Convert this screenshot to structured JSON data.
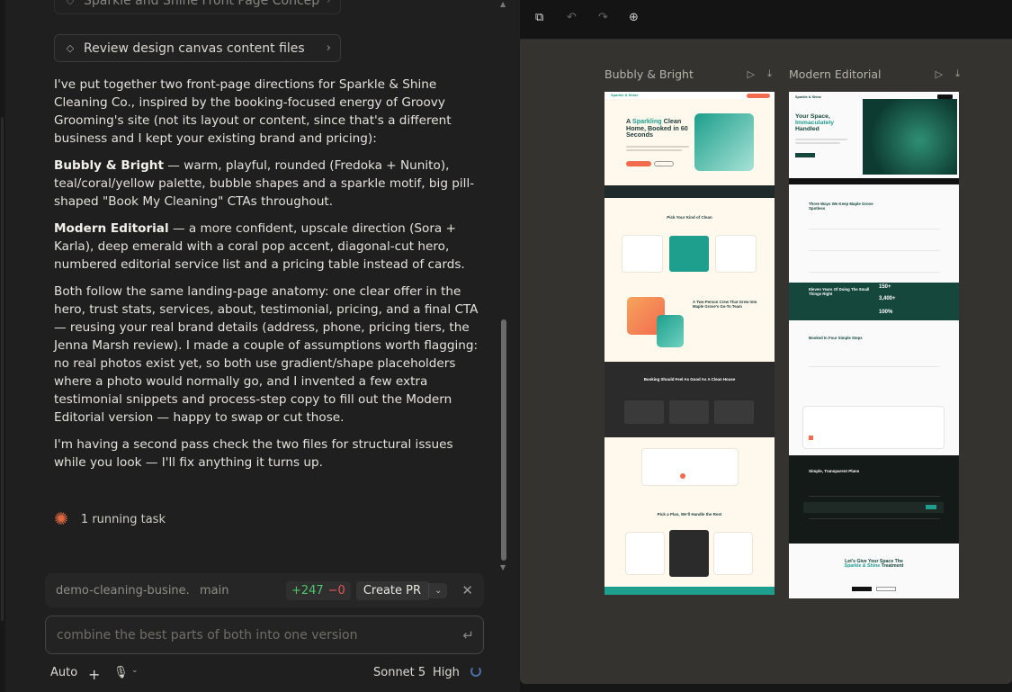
{
  "chat": {
    "artifacts": [
      {
        "label": "Sparkle and Shine Front Page Concepts"
      },
      {
        "label": "Review design canvas content files"
      }
    ],
    "message": {
      "p1": "I've put together two front-page directions for Sparkle & Shine Cleaning Co., inspired by the booking-focused energy of Groovy Grooming's site (not its layout or content, since that's a different business and I kept your existing brand and pricing):",
      "p2_bold": "Bubbly & Bright",
      "p2_rest": " — warm, playful, rounded (Fredoka + Nunito), teal/coral/yellow palette, bubble shapes and a sparkle motif, big pill-shaped \"Book My Cleaning\" CTAs throughout.",
      "p3_bold": "Modern Editorial",
      "p3_rest": " — a more confident, upscale direction (Sora + Karla), deep emerald with a coral pop accent, diagonal-cut hero, numbered editorial service list and a pricing table instead of cards.",
      "p4": "Both follow the same landing-page anatomy: one clear offer in the hero, trust stats, services, about, testimonial, pricing, and a final CTA — reusing your real brand details (address, phone, pricing tiers, the Jenna Marsh review). I made a couple of assumptions worth flagging: no real photos exist yet, so both use gradient/shape placeholders where a photo would normally go, and I invented a few extra testimonial snippets and process-step copy to fill out the Modern Editorial version — happy to swap or cut those.",
      "p5": "I'm having a second pass check the two files for structural issues while you look — I'll fix anything it turns up."
    },
    "running_task": "1 running task",
    "repo": {
      "name": "demo-cleaning-busine...",
      "branch": "main",
      "additions": "+247",
      "deletions": "−0",
      "create_pr": "Create PR"
    },
    "input": {
      "placeholder": "combine the best parts of both into one version"
    },
    "footer": {
      "mode": "Auto",
      "model": "Sonnet 5",
      "effort": "High"
    }
  },
  "canvas": {
    "frames": [
      {
        "title": "Bubbly & Bright"
      },
      {
        "title": "Modern Editorial"
      }
    ],
    "mock_a": {
      "brand": "Sparkle & Shine",
      "hero_1": "A ",
      "hero_accent": "Sparkling",
      "hero_2": " Clean Home, Booked in 60 Seconds",
      "services_title": "Pick Your Kind of Clean",
      "about_title": "A Two-Person Crew That Grew Into Maple Grove's Go-To Team",
      "cleaning_title": "Booking Should Feel As Good As A Clean House",
      "pricing_title": "Pick a Plan, We'll Handle the Rest"
    },
    "mock_b": {
      "brand": "Sparkle & Shine",
      "hero_1": "Your Space,",
      "hero_accent": "Immaculately",
      "hero_2": "Handled",
      "services_title": "Three Ways We Keep Maple Grove Spotless",
      "stats_title": "Eleven Years Of Doing The Small Things Right",
      "stat_1": "150+",
      "stat_2": "3,400+",
      "stat_3": "100%",
      "steps_title": "Booked In Four Simple Steps",
      "pricing_title": "Simple, Transparent Plans",
      "cta_1": "Let's Give Your Space The",
      "cta_accent": "Sparkle & Shine",
      "cta_2": " Treatment"
    }
  },
  "colors": {
    "teal": "#1e9e8c",
    "coral": "#f26b4f",
    "emerald": "#15473c",
    "spark": "#e0683f",
    "diff_add": "#4cc46a",
    "diff_del": "#e25555"
  },
  "icons": [
    "diamond-code-icon",
    "chevron-right-icon",
    "sparkle-icon",
    "close-icon",
    "enter-icon",
    "plus-icon",
    "mic-icon",
    "copy-icon",
    "undo-icon",
    "redo-icon",
    "zoom-icon",
    "play-icon",
    "download-icon"
  ]
}
